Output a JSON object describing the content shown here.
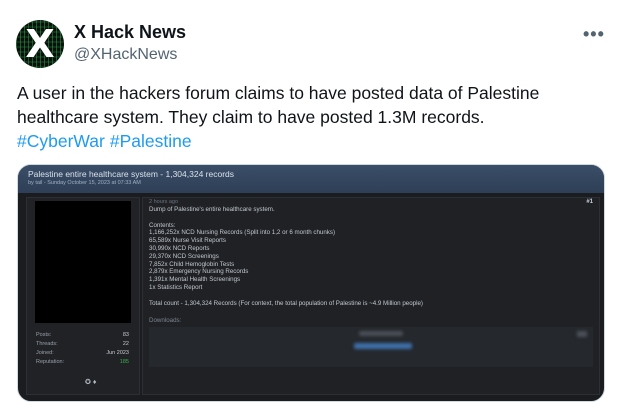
{
  "tweet": {
    "author_name": "X Hack News",
    "handle": "@XHackNews",
    "more_icon": "more-horizontal-icon",
    "avatar_glyph": "X",
    "text": "A user in the hackers forum claims to have posted data of Palestine healthcare system. They claim to have posted 1.3M records.",
    "hashtags": [
      "#CyberWar",
      "#Palestine"
    ],
    "colors": {
      "link": "#1d9bf0",
      "text": "#0f1419",
      "muted": "#536471"
    }
  },
  "forum": {
    "thread_title": "Palestine entire healthcare system - 1,304,324 records",
    "thread_subtitle": "by tail - Sunday October 15, 2023 at 07:33 AM",
    "post_time": "2 hours ago",
    "post_number": "#1",
    "lines": [
      "Dump of Palestine's entire healthcare system.",
      "",
      "Contents:",
      "1,166,252x NCD Nursing Records (Split into 1,2 or 6 month chunks)",
      "65,589x Nurse Visit Reports",
      "30,990x NCD Reports",
      "29,370x NCD Screenings",
      "7,852x Child Hemoglobin Tests",
      "2,879x Emergency Nursing Records",
      "1,391x Mental Health Screenings",
      "1x Statistics Report",
      "",
      "Total count - 1,304,324 Records (For context, the total population of Palestine is ~4.9 Million people)"
    ],
    "downloads_label": "Downloads:",
    "user_stats": {
      "posts_label": "Posts:",
      "posts": "83",
      "threads_label": "Threads:",
      "threads": "22",
      "joined_label": "Joined:",
      "joined": "Jun 2023",
      "reputation_label": "Reputation:",
      "reputation": "185"
    },
    "colors": {
      "header_bar": "#34475f",
      "reputation": "#3bb04a"
    }
  }
}
